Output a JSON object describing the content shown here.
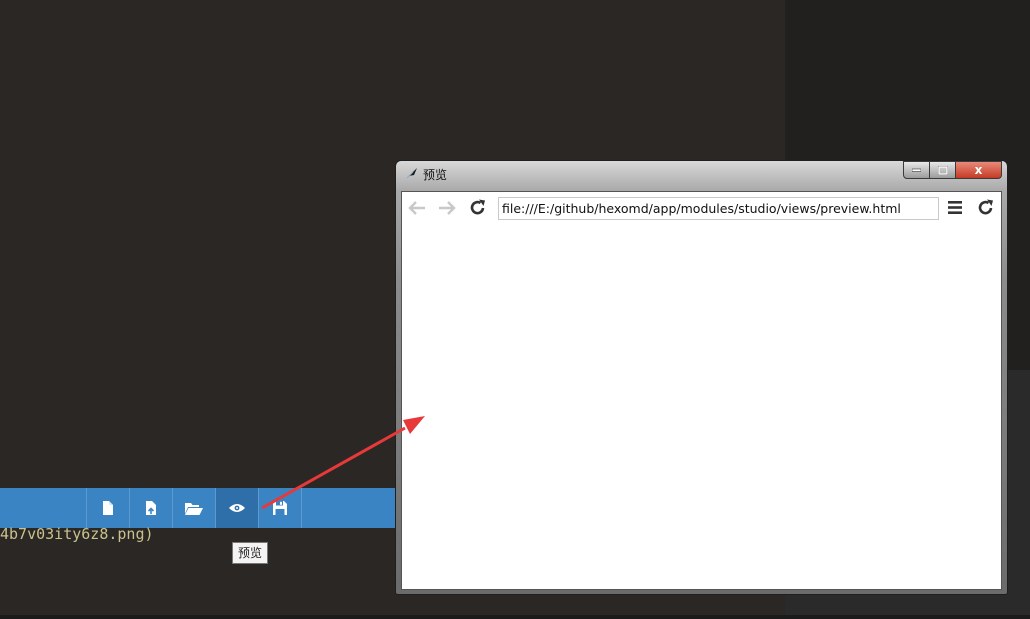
{
  "editor": {
    "code_line": "4b7v03ity6z8.png)",
    "toolbar": {
      "buttons": [
        {
          "name": "new-file",
          "icon": "file-icon"
        },
        {
          "name": "import-file",
          "icon": "file-upload-icon"
        },
        {
          "name": "open-folder",
          "icon": "folder-open-icon"
        },
        {
          "name": "preview",
          "icon": "eye-icon",
          "active": true
        },
        {
          "name": "save",
          "icon": "floppy-disk-icon"
        }
      ]
    },
    "tooltip": "预览"
  },
  "preview_window": {
    "title": "预览",
    "controls": {
      "close_glyph": "x"
    },
    "browser": {
      "address": "file:///E:/github/hexomd/app/modules/studio/views/preview.html"
    }
  },
  "colors": {
    "toolbar_bg": "#3b84c4",
    "toolbar_active": "#2f6fa9",
    "editor_bg": "#2b2725",
    "arrow": "#e8393a"
  }
}
